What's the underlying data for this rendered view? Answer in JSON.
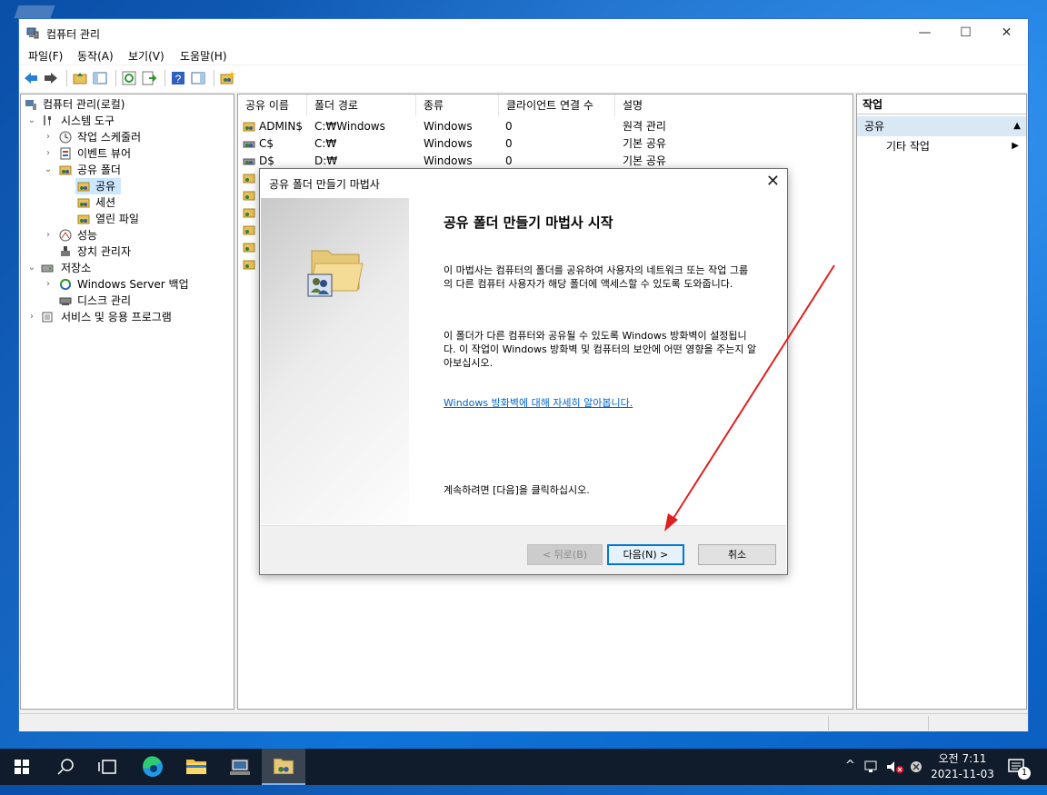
{
  "window": {
    "title": "컴퓨터 관리",
    "controls": [
      "—",
      "☐",
      "✕"
    ]
  },
  "menu": [
    "파일(F)",
    "동작(A)",
    "보기(V)",
    "도움말(H)"
  ],
  "tree": {
    "root": "컴퓨터 관리(로컬)",
    "system_tools": "시스템 도구",
    "task_scheduler": "작업 스케줄러",
    "event_viewer": "이벤트 뷰어",
    "shared_folders": "공유 폴더",
    "shares": "공유",
    "sessions": "세션",
    "open_files": "열린 파일",
    "performance": "성능",
    "device_manager": "장치 관리자",
    "storage": "저장소",
    "wsb": "Windows Server 백업",
    "disk_mgmt": "디스크 관리",
    "services_apps": "서비스 및 응용 프로그램"
  },
  "list": {
    "columns": [
      "공유 이름",
      "폴더 경로",
      "종류",
      "클라이언트 연결 수",
      "설명"
    ],
    "rows": [
      {
        "name": "ADMIN$",
        "path": "C:₩Windows",
        "type": "Windows",
        "clients": "0",
        "desc": "원격 관리"
      },
      {
        "name": "C$",
        "path": "C:₩",
        "type": "Windows",
        "clients": "0",
        "desc": "기본 공유"
      },
      {
        "name": "D$",
        "path": "D:₩",
        "type": "Windows",
        "clients": "0",
        "desc": "기본 공유"
      }
    ]
  },
  "actions": {
    "header": "작업",
    "section": "공유",
    "more": "기타 작업"
  },
  "dialog": {
    "title": "공유 폴더 만들기 마법사",
    "close": "✕",
    "heading": "공유 폴더 만들기 마법사 시작",
    "p1": "이 마법사는 컴퓨터의 폴더를 공유하여 사용자의 네트워크 또는 작업 그룹의 다른 컴퓨터 사용자가 해당 폴더에 액세스할 수 있도록 도와줍니다.",
    "p2": "이 폴더가 다른 컴퓨터와 공유될 수 있도록 Windows 방화벽이 설정됩니다. 이 작업이 Windows 방화벽 및 컴퓨터의 보안에 어떤 영향을 주는지 알아보십시오.",
    "link": "Windows 방화벽에 대해 자세히 알아봅니다.",
    "p3": "계속하려면 [다음]을 클릭하십시오.",
    "back": "< 뒤로(B)",
    "next": "다음(N) >",
    "cancel": "취소"
  },
  "taskbar": {
    "time": "오전 7:11",
    "date": "2021-11-03",
    "notif_count": "1"
  }
}
